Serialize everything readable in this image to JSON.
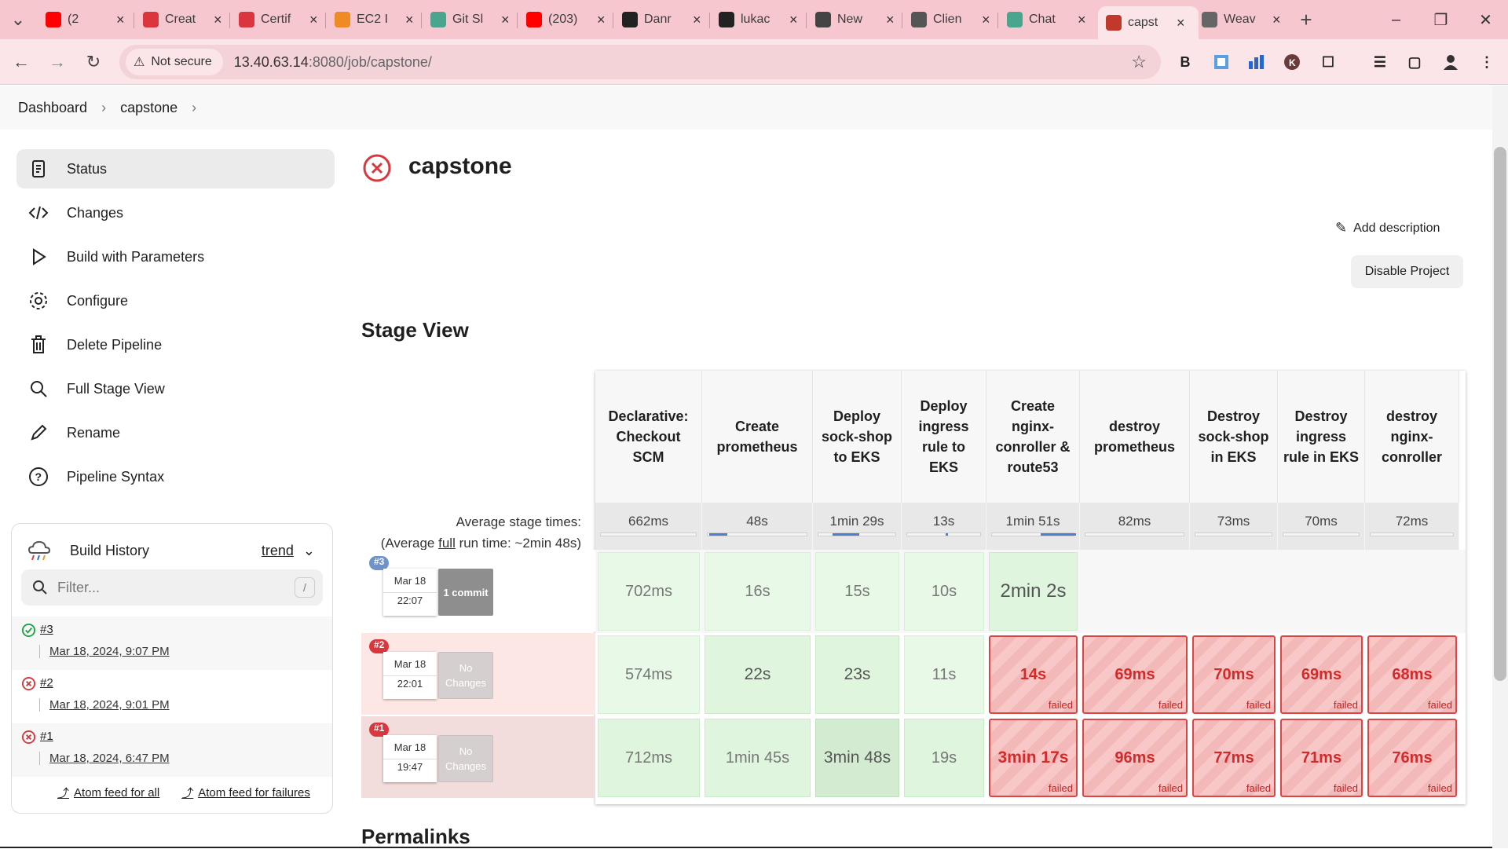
{
  "browser": {
    "tabs": [
      {
        "title": "(2",
        "icon": "youtube-icon",
        "color": "#ff0000"
      },
      {
        "title": "Creat",
        "icon": "certificate-icon",
        "color": "#d9363e"
      },
      {
        "title": "Certif",
        "icon": "certificate-icon",
        "color": "#d9363e"
      },
      {
        "title": "EC2 I",
        "icon": "aws-icon",
        "color": "#f08a24"
      },
      {
        "title": "Git Sl",
        "icon": "chatgpt-icon",
        "color": "#4aa58f"
      },
      {
        "title": "(203)",
        "icon": "youtube-icon",
        "color": "#ff0000"
      },
      {
        "title": "Danr",
        "icon": "github-icon",
        "color": "#222222"
      },
      {
        "title": "lukac",
        "icon": "github-icon",
        "color": "#222222"
      },
      {
        "title": "New",
        "icon": "chrome-icon",
        "color": "#444444"
      },
      {
        "title": "Clien",
        "icon": "globe-icon",
        "color": "#555555"
      },
      {
        "title": "Chat",
        "icon": "chatgpt-icon",
        "color": "#4aa58f"
      },
      {
        "title": "capst",
        "icon": "jenkins-icon",
        "color": "#c0392b",
        "active": true
      },
      {
        "title": "Weav",
        "icon": "weave-icon",
        "color": "#666666"
      }
    ],
    "security_label": "Not secure",
    "url_host": "13.40.63.14",
    "url_path": ":8080/job/capstone/"
  },
  "breadcrumb": {
    "items": [
      "Dashboard",
      "capstone"
    ]
  },
  "sidebar": {
    "items": [
      {
        "label": "Status",
        "icon": "status-icon"
      },
      {
        "label": "Changes",
        "icon": "code-icon"
      },
      {
        "label": "Build with Parameters",
        "icon": "play-icon"
      },
      {
        "label": "Configure",
        "icon": "gear-icon"
      },
      {
        "label": "Delete Pipeline",
        "icon": "trash-icon"
      },
      {
        "label": "Full Stage View",
        "icon": "search-icon"
      },
      {
        "label": "Rename",
        "icon": "pencil-icon"
      },
      {
        "label": "Pipeline Syntax",
        "icon": "help-icon"
      }
    ]
  },
  "build_history": {
    "title": "Build History",
    "trend_label": "trend",
    "filter_placeholder": "Filter...",
    "filter_key": "/",
    "builds": [
      {
        "number": "#3",
        "date": "Mar 18, 2024, 9:07 PM",
        "status": "success"
      },
      {
        "number": "#2",
        "date": "Mar 18, 2024, 9:01 PM",
        "status": "failed"
      },
      {
        "number": "#1",
        "date": "Mar 18, 2024, 6:47 PM",
        "status": "failed"
      }
    ],
    "feed_all": "Atom feed for all",
    "feed_failures": "Atom feed for failures"
  },
  "main": {
    "title": "capstone",
    "add_description": "Add description",
    "disable_project": "Disable Project",
    "stage_view_heading": "Stage View",
    "permalinks_heading": "Permalinks"
  },
  "stage_view": {
    "avg_label_1": "Average stage times:",
    "avg_label_2_prefix": "(Average ",
    "avg_label_2_link": "full",
    "avg_label_2_suffix": " run time: ~2min 48s)",
    "stages": [
      {
        "name": "Declarative: Checkout SCM",
        "avg": "662ms",
        "avg_fraction": 0.0
      },
      {
        "name": "Create prometheus",
        "avg": "48s",
        "avg_fraction": 0.18
      },
      {
        "name": "Deploy sock-shop to EKS",
        "avg": "1min 29s",
        "avg_fraction": 0.33
      },
      {
        "name": "Deploy ingress rule to EKS",
        "avg": "13s",
        "avg_fraction": 0.03
      },
      {
        "name": "Create nginx-conroller & route53",
        "avg": "1min 51s",
        "avg_fraction": 0.42
      },
      {
        "name": "destroy prometheus",
        "avg": "82ms",
        "avg_fraction": 0.0
      },
      {
        "name": "Destroy sock-shop in EKS",
        "avg": "73ms",
        "avg_fraction": 0.0
      },
      {
        "name": "Destroy ingress rule in EKS",
        "avg": "70ms",
        "avg_fraction": 0.0
      },
      {
        "name": "destroy nginx-conroller",
        "avg": "72ms",
        "avg_fraction": 0.0
      }
    ],
    "runs": [
      {
        "badge": "#3",
        "date": "Mar 18",
        "time": "22:07",
        "changes": "1 commit",
        "status": "success",
        "cells": [
          "702ms",
          "16s",
          "15s",
          "10s",
          "2min 2s",
          "",
          "",
          "",
          ""
        ]
      },
      {
        "badge": "#2",
        "date": "Mar 18",
        "time": "22:01",
        "changes": "No Changes",
        "status": "failed",
        "cells": [
          "574ms",
          "22s",
          "23s",
          "11s",
          "14s",
          "69ms",
          "70ms",
          "69ms",
          "68ms"
        ]
      },
      {
        "badge": "#1",
        "date": "Mar 18",
        "time": "19:47",
        "changes": "No Changes",
        "status": "failed",
        "cells": [
          "712ms",
          "1min 45s",
          "3min 48s",
          "19s",
          "3min 17s",
          "96ms",
          "77ms",
          "71ms",
          "76ms"
        ]
      }
    ],
    "failed_label": "failed"
  },
  "colors": {
    "success_cell": "#dff5de",
    "failed_cell": "#f8c8c8",
    "failed_border": "#d94646",
    "accent_blue": "#4a7fd1",
    "tab_strip": "#f7c7cf"
  }
}
